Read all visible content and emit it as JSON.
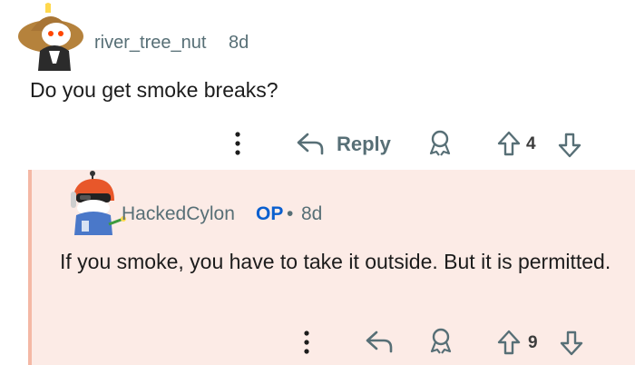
{
  "comment": {
    "username": "river_tree_nut",
    "age": "8d",
    "body": "Do you get smoke breaks?",
    "actions": {
      "reply_label": "Reply",
      "vote_count": "4"
    }
  },
  "reply": {
    "username": "HackedCylon",
    "op_badge": "OP",
    "separator": "•",
    "age": "8d",
    "body": "If you smoke, you have to take it outside. But it is permitted.",
    "actions": {
      "vote_count": "9"
    }
  },
  "colors": {
    "highlight_bg": "#fcebe6",
    "highlight_border": "#f4b8a5",
    "op_blue": "#0a5fcf",
    "meta_gray": "#576f76"
  }
}
